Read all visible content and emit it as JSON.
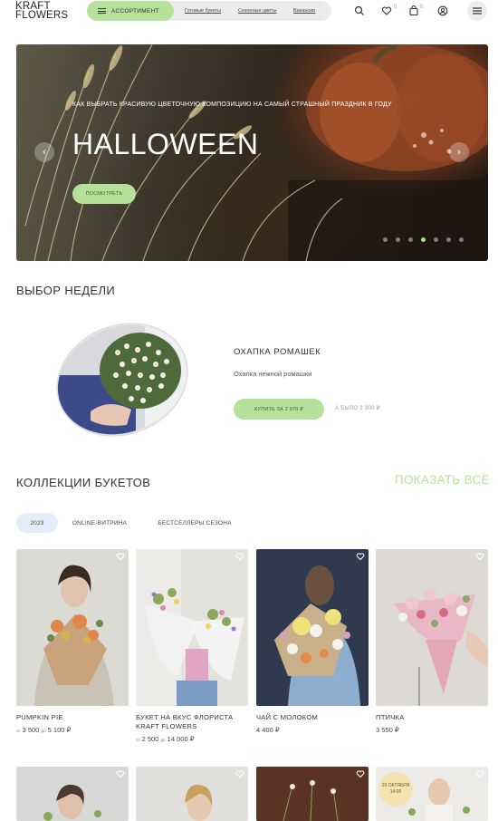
{
  "header": {
    "logo_line1": "KRAFT",
    "logo_line2": "FLOWERS",
    "assortment_label": "АССОРТИМЕНТ",
    "nav_links": [
      "Готовые букеты",
      "Сезонные цветы",
      "Вакансии"
    ],
    "favorites_count": "0",
    "cart_count": "0"
  },
  "hero": {
    "subtitle": "КАК ВЫБРАТЬ КРАСИВУЮ ЦВЕТОЧНУЮ КОМПОЗИЦИЮ НА САМЫЙ СТРАШНЫЙ ПРАЗДНИК В ГОДУ",
    "title": "HALLOWEEN",
    "button_label": "ПОСМОТРЕТЬ",
    "prev_arrow": "‹",
    "next_arrow": "›",
    "slides_total": 7,
    "active_slide": 4
  },
  "week": {
    "section_title": "ВЫБОР НЕДЕЛИ",
    "product_name": "ОХАПКА РОМАШЕК",
    "product_desc": "Охапка нежной ромашки",
    "buy_label": "КУПИТЬ ЗА 2 970 ₽",
    "was_price": "А БЫЛО 3 300 ₽"
  },
  "collections": {
    "section_title": "КОЛЛЕКЦИИ БУКЕТОВ",
    "show_all": "ПОКАЗАТЬ ВСЁ",
    "tabs": [
      "2023",
      "ONLINE-ВИТРИНА",
      "БЕСТСЕЛЛЕРЫ СЕЗОНА"
    ],
    "active_tab": "2023",
    "cards": [
      {
        "name": "PUMPKIN PIE",
        "price_from_label": "от",
        "price_from": "3 500",
        "price_to_label": "до",
        "price_to": "5 100 ₽"
      },
      {
        "name": "БУКЕТ НА ВКУС ФЛОРИСТА KRAFT FLOWERS",
        "price_from_label": "от",
        "price_from": "2 500",
        "price_to_label": "до",
        "price_to": "14 000 ₽"
      },
      {
        "name": "ЧАЙ С МОЛОКОМ",
        "price": "4 400 ₽"
      },
      {
        "name": "ПТИЧКА",
        "price": "3 550 ₽"
      }
    ],
    "date_badge": "29 ОКТЯБРЯ 14:00"
  },
  "colors": {
    "accent_green": "#b6e19a",
    "tab_active_bg": "#e4eefa"
  }
}
